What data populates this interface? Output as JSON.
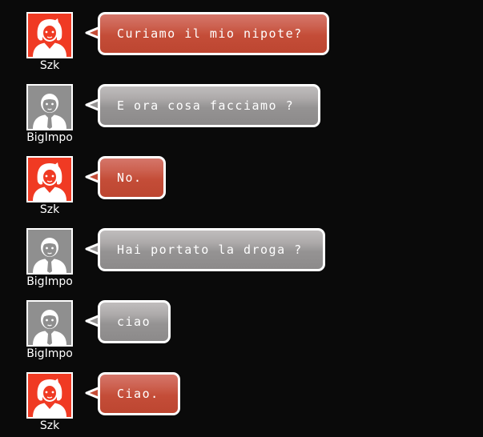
{
  "colors": {
    "background": "#0a0a0a",
    "bubble_red": "#c44d38",
    "bubble_gray": "#959393",
    "avatar_red": "#f03a23",
    "avatar_gray": "#8f8f8f",
    "border": "#ffffff"
  },
  "messages": [
    {
      "user": "Szk",
      "avatar": "female-user-icon",
      "variant": "red",
      "text": "Curiamo il mio nipote?"
    },
    {
      "user": "BigImpo",
      "avatar": "male-user-icon",
      "variant": "gray",
      "text": "E ora cosa facciamo ?"
    },
    {
      "user": "Szk",
      "avatar": "female-user-icon",
      "variant": "red",
      "text": "No."
    },
    {
      "user": "BigImpo",
      "avatar": "male-user-icon",
      "variant": "gray",
      "text": "Hai portato la droga ?"
    },
    {
      "user": "BigImpo",
      "avatar": "male-user-icon",
      "variant": "gray",
      "text": "ciao"
    },
    {
      "user": "Szk",
      "avatar": "female-user-icon",
      "variant": "red",
      "text": "Ciao."
    }
  ]
}
